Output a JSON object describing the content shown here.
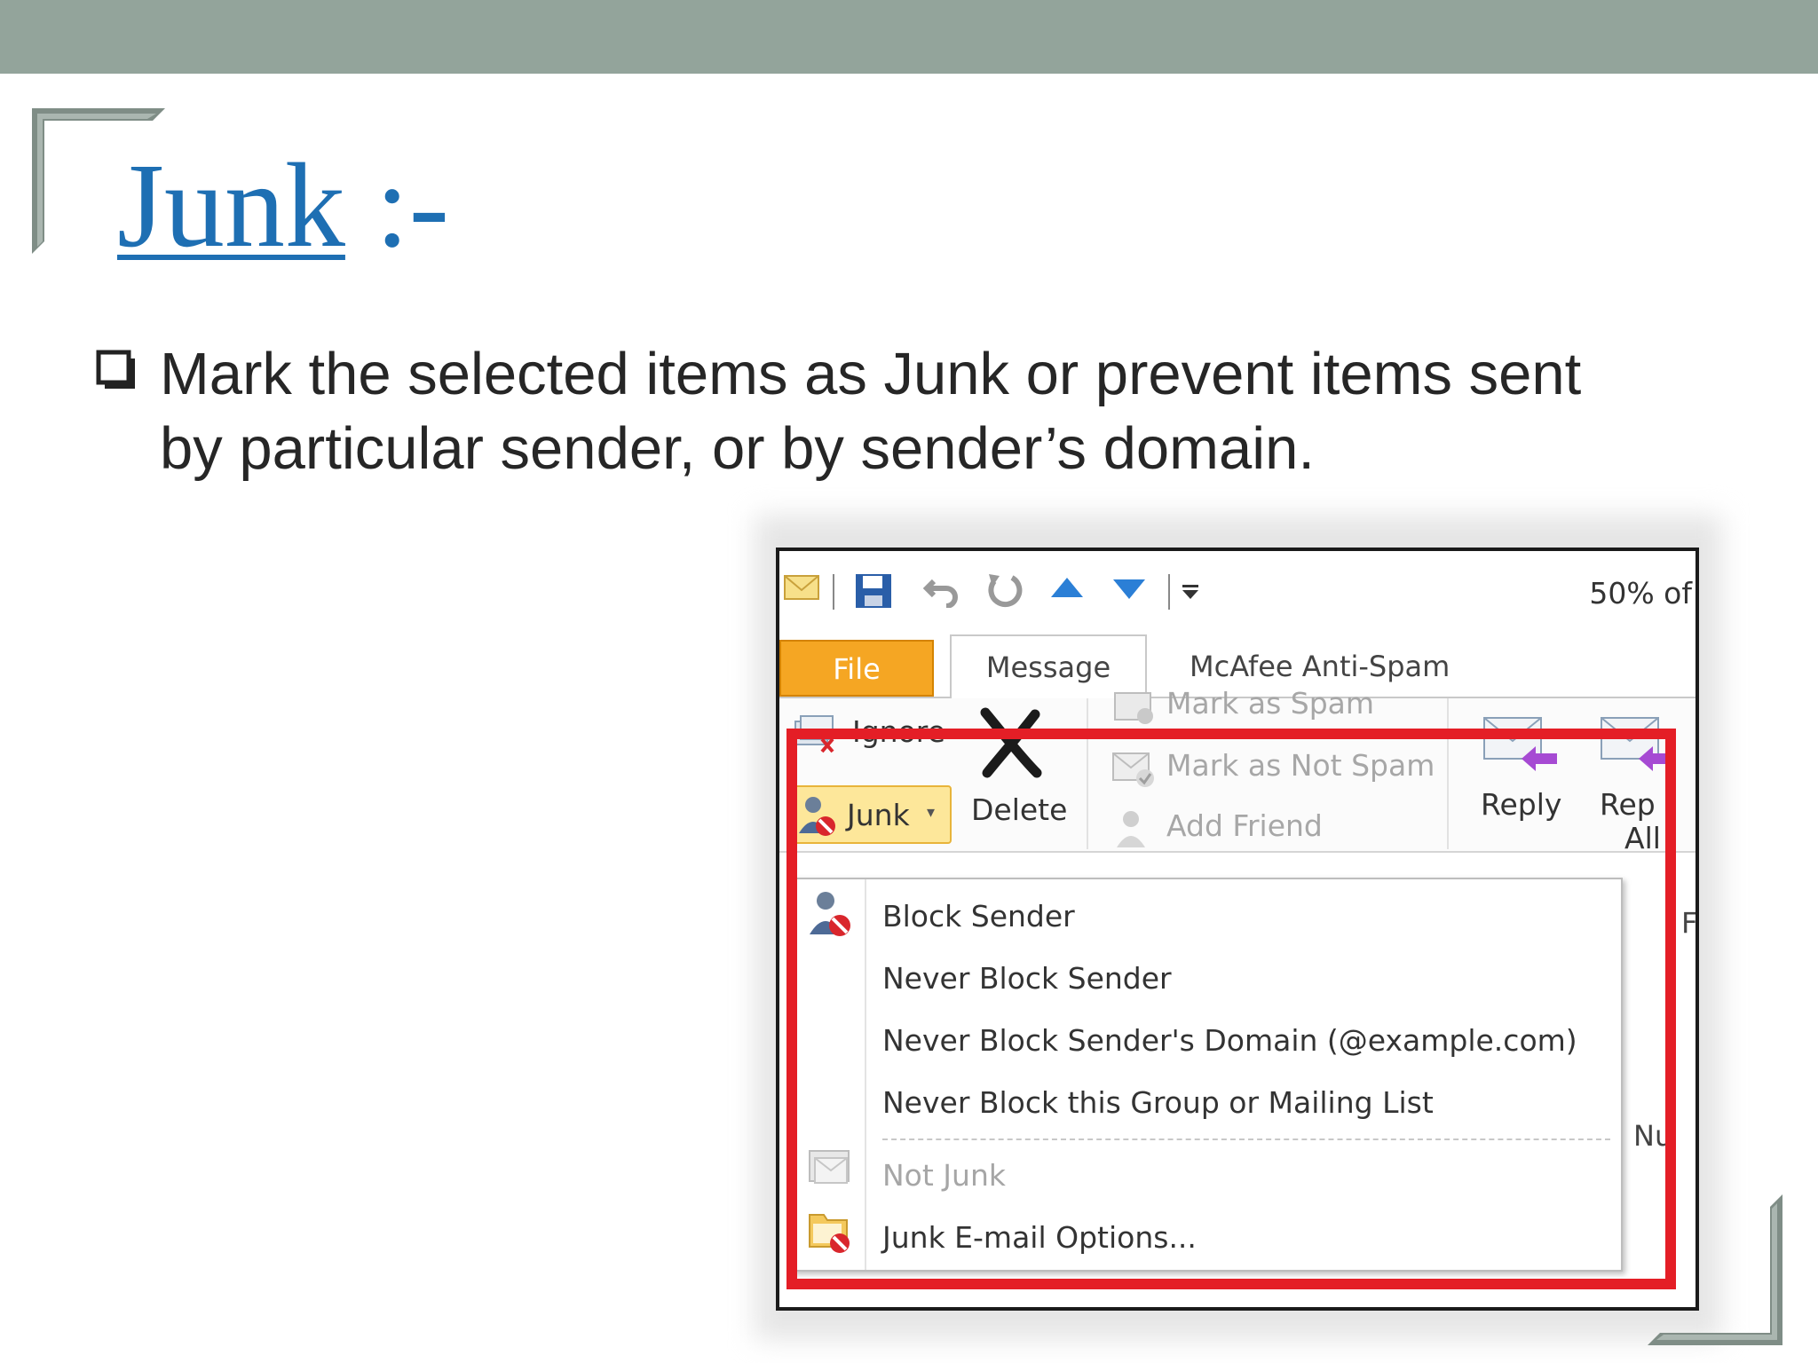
{
  "slide": {
    "title": "Junk",
    "title_suffix": " :-",
    "bullet": "Mark the selected items as Junk or prevent items sent by particular sender, or by sender’s domain."
  },
  "outlook": {
    "zoom_text": "50% of",
    "tabs": {
      "file": "File",
      "message": "Message",
      "mcafee": "McAfee Anti-Spam"
    },
    "ribbon": {
      "ignore": "Ignore",
      "junk": "Junk",
      "delete": "Delete",
      "mark_spam": "Mark as Spam",
      "mark_not_spam": "Mark as Not Spam",
      "add_friend": "Add Friend",
      "reply": "Reply",
      "reply_all_1": "Rep",
      "reply_all_2": "All"
    },
    "menu": {
      "items": [
        "Block Sender",
        "Never Block Sender",
        "Never Block Sender's Domain (@example.com)",
        "Never Block this Group or Mailing List",
        "Not Junk",
        "Junk E-mail Options..."
      ]
    },
    "side_fragments": {
      "f": "F",
      "num": "Nu"
    }
  },
  "colors": {
    "header_bar": "#93a49b",
    "title_blue": "#1e6fb3",
    "file_tab": "#f5a623",
    "highlight_red": "#e41e26"
  },
  "icons": [
    "envelope-icon",
    "save-icon",
    "undo-icon",
    "redo-icon",
    "up-arrow-icon",
    "down-arrow-icon",
    "customize-icon",
    "ignore-icon",
    "junk-icon",
    "delete-x-icon",
    "mark-spam-icon",
    "mark-not-spam-icon",
    "add-friend-icon",
    "reply-icon",
    "reply-all-icon",
    "block-sender-icon",
    "not-junk-icon",
    "junk-options-icon",
    "checkbox-bullet-icon"
  ]
}
